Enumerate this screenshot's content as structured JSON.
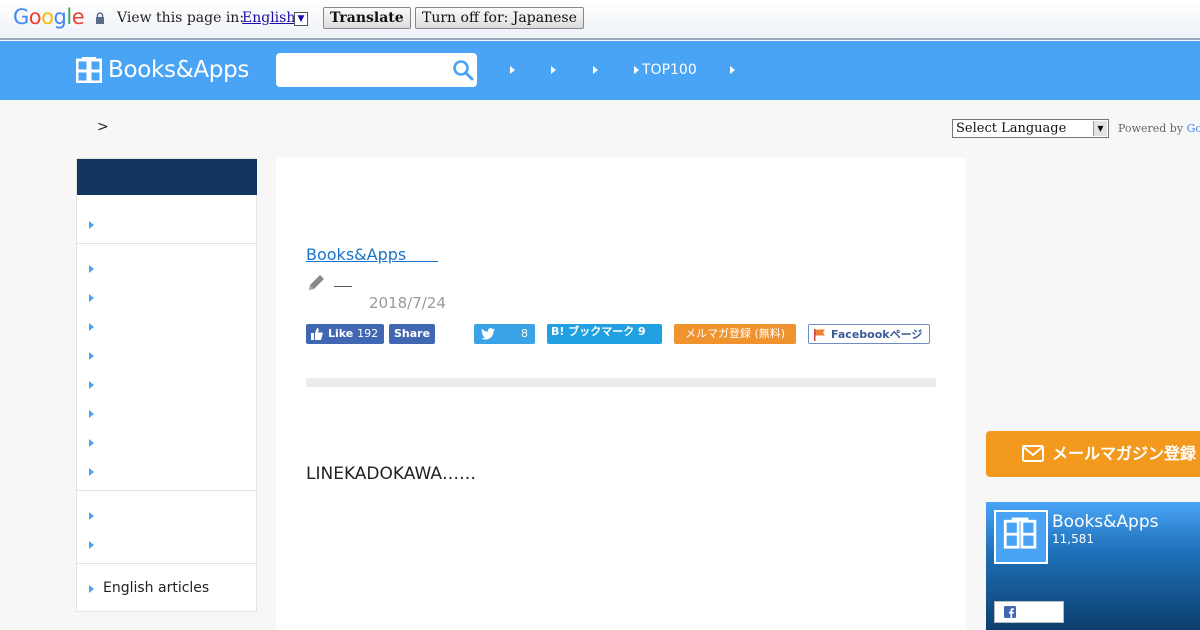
{
  "translate_bar": {
    "logo": "Google",
    "view_label": "View this page in:",
    "language": "English",
    "translate_button": "Translate",
    "turn_off_button": "Turn off for: Japanese"
  },
  "header": {
    "logo_text": "Books&Apps",
    "search_placeholder": "",
    "nav": [
      {
        "label": ""
      },
      {
        "label": ""
      },
      {
        "label": ""
      },
      {
        "label": "TOP100"
      },
      {
        "label": ""
      }
    ]
  },
  "breadcrumb": {
    "separator": ">"
  },
  "language_select": {
    "selected": "Select Language",
    "powered_by": "Powered by ",
    "powered_brand": "Go"
  },
  "sidebar": {
    "items": [
      {
        "label": ""
      },
      {
        "label": ""
      },
      {
        "label": ""
      },
      {
        "label": ""
      },
      {
        "label": ""
      },
      {
        "label": ""
      },
      {
        "label": ""
      },
      {
        "label": ""
      },
      {
        "label": ""
      },
      {
        "label": ""
      },
      {
        "label": ""
      },
      {
        "label": "English articles"
      }
    ]
  },
  "article": {
    "category_link": "Books&Apps　　",
    "author": "",
    "date": "2018/7/24",
    "lead": "LINEKADOKAWA……"
  },
  "share": {
    "like_label": "Like",
    "like_count": "192",
    "share_label": "Share",
    "tweet_count": "8",
    "hatena_label": "B! ブックマーク 9",
    "mailmag_label": "メルマガ登録 (無料)",
    "facebook_page_label": "Facebookページ"
  },
  "right": {
    "mail_banner": "メールマガジン登録",
    "fb_widget_name": "Books&Apps",
    "fb_widget_count": "11,581"
  },
  "colors": {
    "header_blue": "#4aa4f6",
    "sidebar_head": "#13365e",
    "mail_orange": "#f39a1e",
    "facebook": "#4267b2"
  },
  "icons": [
    "lock-icon",
    "search-icon",
    "pencil-icon",
    "thumbs-up-icon",
    "twitter-icon",
    "flag-icon",
    "mail-icon",
    "facebook-icon"
  ]
}
